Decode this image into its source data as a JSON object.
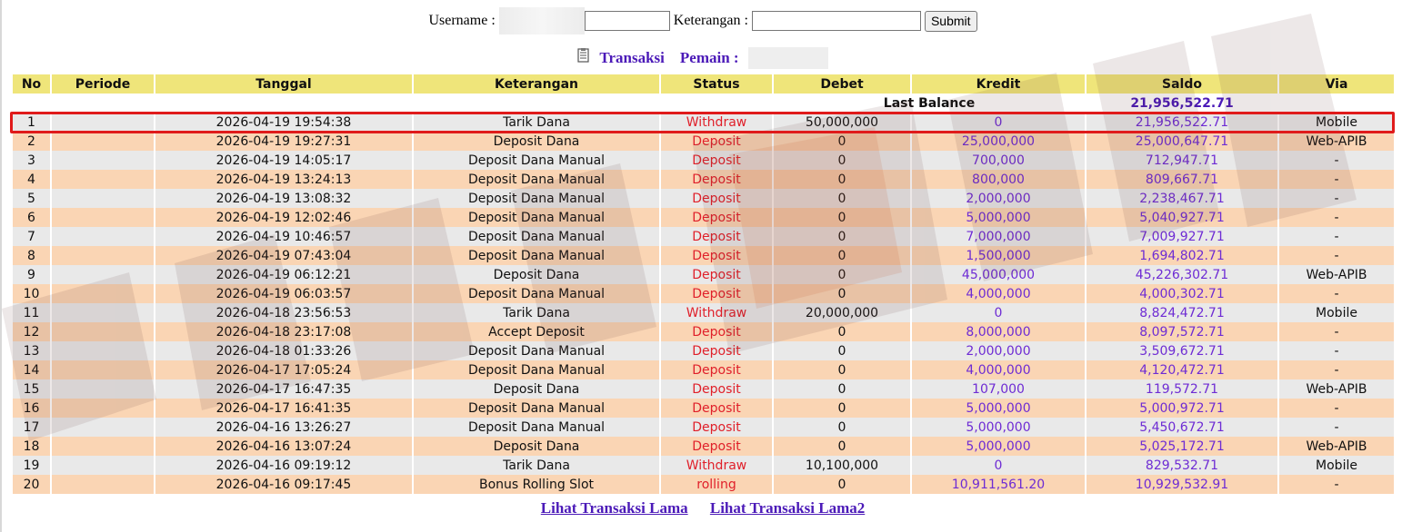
{
  "search": {
    "username_label": "Username :",
    "keterangan_label": "Keterangan :",
    "username_value": "",
    "keterangan_value": "",
    "submit_label": "Submit"
  },
  "header": {
    "transaksi_label": "Transaksi",
    "pemain_label": "Pemain :"
  },
  "table": {
    "columns": [
      "No",
      "Periode",
      "Tanggal",
      "Keterangan",
      "Status",
      "Debet",
      "Kredit",
      "Saldo",
      "Via"
    ],
    "last_balance_label": "Last Balance",
    "last_balance_value": "21,956,522.71",
    "rows": [
      {
        "no": "1",
        "periode": "",
        "tanggal": "2026-04-19 19:54:38",
        "keterangan": "Tarik Dana",
        "status": "Withdraw",
        "debet": "50,000,000",
        "kredit": "0",
        "saldo": "21,956,522.71",
        "via": "Mobile"
      },
      {
        "no": "2",
        "periode": "",
        "tanggal": "2026-04-19 19:27:31",
        "keterangan": "Deposit Dana",
        "status": "Deposit",
        "debet": "0",
        "kredit": "25,000,000",
        "saldo": "25,000,647.71",
        "via": "Web-APIB"
      },
      {
        "no": "3",
        "periode": "",
        "tanggal": "2026-04-19 14:05:17",
        "keterangan": "Deposit Dana Manual",
        "status": "Deposit",
        "debet": "0",
        "kredit": "700,000",
        "saldo": "712,947.71",
        "via": "-"
      },
      {
        "no": "4",
        "periode": "",
        "tanggal": "2026-04-19 13:24:13",
        "keterangan": "Deposit Dana Manual",
        "status": "Deposit",
        "debet": "0",
        "kredit": "800,000",
        "saldo": "809,667.71",
        "via": "-"
      },
      {
        "no": "5",
        "periode": "",
        "tanggal": "2026-04-19 13:08:32",
        "keterangan": "Deposit Dana Manual",
        "status": "Deposit",
        "debet": "0",
        "kredit": "2,000,000",
        "saldo": "2,238,467.71",
        "via": "-"
      },
      {
        "no": "6",
        "periode": "",
        "tanggal": "2026-04-19 12:02:46",
        "keterangan": "Deposit Dana Manual",
        "status": "Deposit",
        "debet": "0",
        "kredit": "5,000,000",
        "saldo": "5,040,927.71",
        "via": "-"
      },
      {
        "no": "7",
        "periode": "",
        "tanggal": "2026-04-19 10:46:57",
        "keterangan": "Deposit Dana Manual",
        "status": "Deposit",
        "debet": "0",
        "kredit": "7,000,000",
        "saldo": "7,009,927.71",
        "via": "-"
      },
      {
        "no": "8",
        "periode": "",
        "tanggal": "2026-04-19 07:43:04",
        "keterangan": "Deposit Dana Manual",
        "status": "Deposit",
        "debet": "0",
        "kredit": "1,500,000",
        "saldo": "1,694,802.71",
        "via": "-"
      },
      {
        "no": "9",
        "periode": "",
        "tanggal": "2026-04-19 06:12:21",
        "keterangan": "Deposit Dana",
        "status": "Deposit",
        "debet": "0",
        "kredit": "45,000,000",
        "saldo": "45,226,302.71",
        "via": "Web-APIB"
      },
      {
        "no": "10",
        "periode": "",
        "tanggal": "2026-04-19 06:03:57",
        "keterangan": "Deposit Dana Manual",
        "status": "Deposit",
        "debet": "0",
        "kredit": "4,000,000",
        "saldo": "4,000,302.71",
        "via": "-"
      },
      {
        "no": "11",
        "periode": "",
        "tanggal": "2026-04-18 23:56:53",
        "keterangan": "Tarik Dana",
        "status": "Withdraw",
        "debet": "20,000,000",
        "kredit": "0",
        "saldo": "8,824,472.71",
        "via": "Mobile"
      },
      {
        "no": "12",
        "periode": "",
        "tanggal": "2026-04-18 23:17:08",
        "keterangan": "Accept Deposit",
        "status": "Deposit",
        "debet": "0",
        "kredit": "8,000,000",
        "saldo": "8,097,572.71",
        "via": "-"
      },
      {
        "no": "13",
        "periode": "",
        "tanggal": "2026-04-18 01:33:26",
        "keterangan": "Deposit Dana Manual",
        "status": "Deposit",
        "debet": "0",
        "kredit": "2,000,000",
        "saldo": "3,509,672.71",
        "via": "-"
      },
      {
        "no": "14",
        "periode": "",
        "tanggal": "2026-04-17 17:05:24",
        "keterangan": "Deposit Dana Manual",
        "status": "Deposit",
        "debet": "0",
        "kredit": "4,000,000",
        "saldo": "4,120,472.71",
        "via": "-"
      },
      {
        "no": "15",
        "periode": "",
        "tanggal": "2026-04-17 16:47:35",
        "keterangan": "Deposit Dana",
        "status": "Deposit",
        "debet": "0",
        "kredit": "107,000",
        "saldo": "119,572.71",
        "via": "Web-APIB"
      },
      {
        "no": "16",
        "periode": "",
        "tanggal": "2026-04-17 16:41:35",
        "keterangan": "Deposit Dana Manual",
        "status": "Deposit",
        "debet": "0",
        "kredit": "5,000,000",
        "saldo": "5,000,972.71",
        "via": "-"
      },
      {
        "no": "17",
        "periode": "",
        "tanggal": "2026-04-16 13:26:27",
        "keterangan": "Deposit Dana Manual",
        "status": "Deposit",
        "debet": "0",
        "kredit": "5,000,000",
        "saldo": "5,450,672.71",
        "via": "-"
      },
      {
        "no": "18",
        "periode": "",
        "tanggal": "2026-04-16 13:07:24",
        "keterangan": "Deposit Dana",
        "status": "Deposit",
        "debet": "0",
        "kredit": "5,000,000",
        "saldo": "5,025,172.71",
        "via": "Web-APIB"
      },
      {
        "no": "19",
        "periode": "",
        "tanggal": "2026-04-16 09:19:12",
        "keterangan": "Tarik Dana",
        "status": "Withdraw",
        "debet": "10,100,000",
        "kredit": "0",
        "saldo": "829,532.71",
        "via": "Mobile"
      },
      {
        "no": "20",
        "periode": "",
        "tanggal": "2026-04-16 09:17:45",
        "keterangan": "Bonus Rolling Slot",
        "status": "rolling",
        "debet": "0",
        "kredit": "10,911,561.20",
        "saldo": "10,929,532.91",
        "via": "-"
      }
    ]
  },
  "footer": {
    "link1": "Lihat Transaksi Lama",
    "link2": "Lihat Transaksi Lama2"
  },
  "colors": {
    "header_bg": "#efe57a",
    "row_odd": "#e9e9e9",
    "row_even": "#fad5b4",
    "status_red": "#e0202a",
    "amount_purple": "#6e2cd4",
    "title_purple": "#4b1ab8",
    "highlight_red": "#e01b1b"
  },
  "icons": {
    "title_icon": "document-icon"
  }
}
